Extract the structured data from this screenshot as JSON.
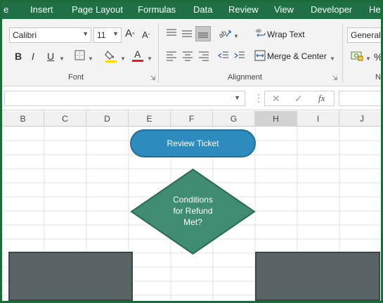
{
  "ribbon": {
    "tabs": [
      "e",
      "Insert",
      "Page Layout",
      "Formulas",
      "Data",
      "Review",
      "View",
      "Developer",
      "Help"
    ],
    "font": {
      "name": "Calibri",
      "size": "11",
      "bold": "B",
      "italic": "I",
      "underline": "U",
      "group_label": "Font"
    },
    "alignment": {
      "wrap_text": "Wrap Text",
      "merge_center": "Merge & Center",
      "group_label": "Alignment"
    },
    "number": {
      "format": "General",
      "group_label": "Nu"
    }
  },
  "grid": {
    "columns": [
      "B",
      "C",
      "D",
      "E",
      "F",
      "G",
      "H",
      "I",
      "J"
    ],
    "selected_column": "H"
  },
  "flowchart": {
    "start_label": "Review Ticket",
    "decision_label": [
      "Conditions",
      "for Refund",
      "Met?"
    ]
  },
  "colors": {
    "tab_bar": "#1f7145",
    "start_fill": "#2e8bbd",
    "decision_fill": "#3f8c73",
    "box_fill": "#5a6465"
  }
}
